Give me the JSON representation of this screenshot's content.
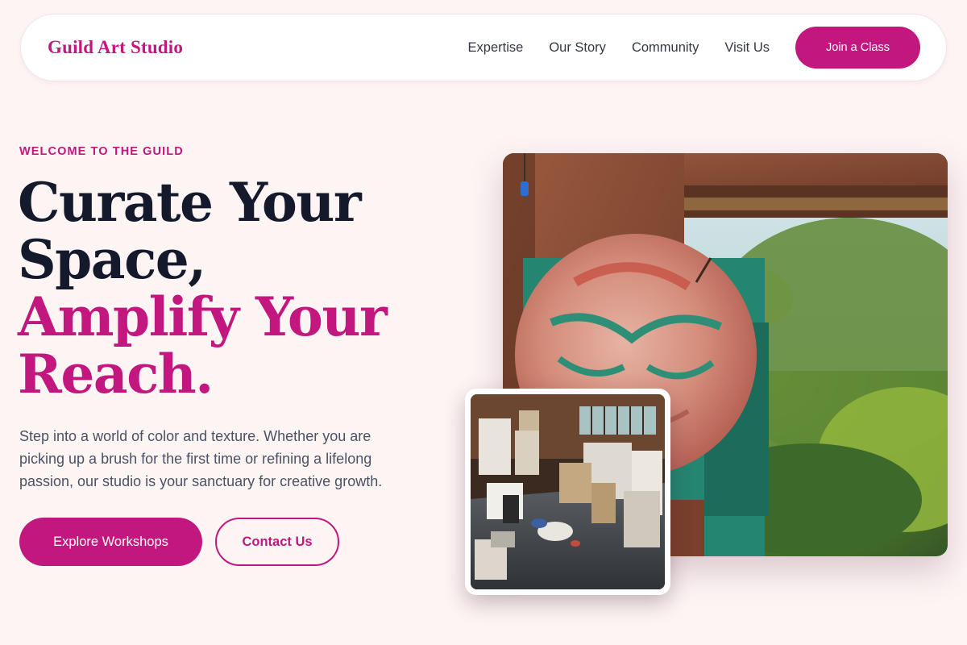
{
  "brand": {
    "name": "Guild Art Studio"
  },
  "nav": {
    "links": [
      {
        "label": "Expertise"
      },
      {
        "label": "Our Story"
      },
      {
        "label": "Community"
      },
      {
        "label": "Visit Us"
      }
    ],
    "cta_label": "Join a Class"
  },
  "hero": {
    "eyebrow": "WELCOME TO THE GUILD",
    "headline": {
      "line1": "Curate Your",
      "line2": "Space,",
      "line3": "Amplify Your",
      "line4": "Reach."
    },
    "lede": "Step into a world of color and texture. Whether you are picking up a brush for the first time or refining a lifelong passion, our studio is your sanctuary for creative growth.",
    "primary_cta": "Explore Workshops",
    "secondary_cta": "Contact Us"
  },
  "colors": {
    "accent": "#c2177e",
    "background": "#fdf4f4",
    "heading": "#141a2c",
    "body_text": "#4b5263"
  }
}
